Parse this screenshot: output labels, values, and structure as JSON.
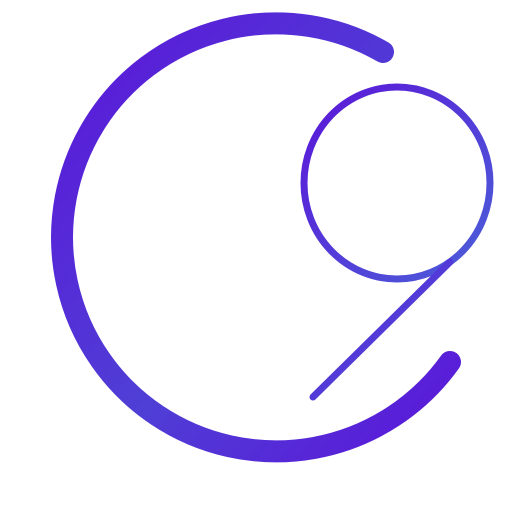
{
  "logo": {
    "icon": "c9-logo-icon",
    "colors": {
      "primary": "#5B16D8",
      "secondary": "#4B5FD8",
      "background": "#ffffff"
    }
  }
}
